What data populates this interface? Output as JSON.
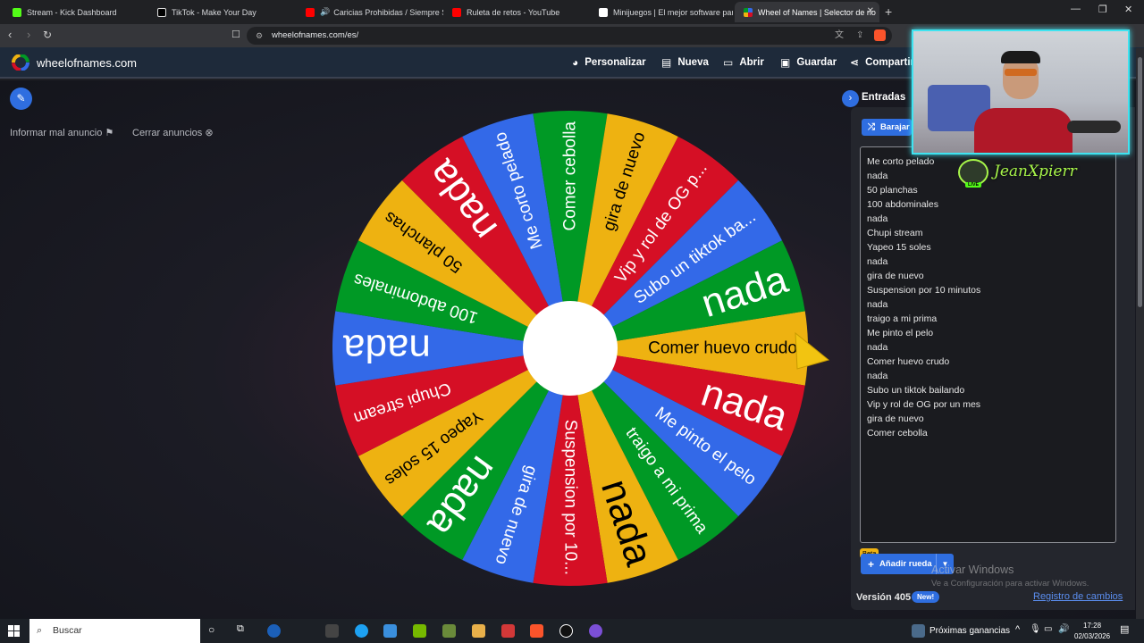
{
  "browser": {
    "tabs": [
      {
        "title": "Stream - Kick Dashboard",
        "color": "#53fc18"
      },
      {
        "title": "TikTok - Make Your Day",
        "color": "#000000"
      },
      {
        "title": "Caricias Prohibidas / Siempre Ser",
        "color": "#ff0000"
      },
      {
        "title": "Ruleta de retos - YouTube",
        "color": "#ff0000"
      },
      {
        "title": "Minijuegos | El mejor software para ¡",
        "color": "#ffffff"
      },
      {
        "title": "Wheel of Names | Selector de no",
        "color": "#3369e8"
      }
    ],
    "url": "wheelofnames.com/es/"
  },
  "site": {
    "logo": "wheelofnames.com",
    "menu": [
      "Personalizar",
      "Nueva",
      "Abrir",
      "Guardar",
      "Compartir"
    ]
  },
  "ads": {
    "report": "Informar mal anuncio",
    "close": "Cerrar anuncios"
  },
  "wheel": {
    "slices": [
      {
        "text": "Comer huevo crudo",
        "color": "#eeb211",
        "big": false
      },
      {
        "text": "nada",
        "color": "#d50f25",
        "big": true
      },
      {
        "text": "Me pinto el pelo",
        "color": "#3369e8",
        "big": false
      },
      {
        "text": "traigo a mi prima",
        "color": "#009925",
        "big": false
      },
      {
        "text": "nada",
        "color": "#eeb211",
        "big": true
      },
      {
        "text": "Suspension por 10...",
        "color": "#d50f25",
        "big": false
      },
      {
        "text": "gira de nuevo",
        "color": "#3369e8",
        "big": false
      },
      {
        "text": "nada",
        "color": "#009925",
        "big": true
      },
      {
        "text": "Yapeo 15 soles",
        "color": "#eeb211",
        "big": false
      },
      {
        "text": "Chupi stream",
        "color": "#d50f25",
        "big": false
      },
      {
        "text": "nada",
        "color": "#3369e8",
        "big": true
      },
      {
        "text": "100 abdominales",
        "color": "#009925",
        "big": false
      },
      {
        "text": "50 planchas",
        "color": "#eeb211",
        "big": false
      },
      {
        "text": "nada",
        "color": "#d50f25",
        "big": true
      },
      {
        "text": "Me corto pelado",
        "color": "#3369e8",
        "big": false
      },
      {
        "text": "Comer cebolla",
        "color": "#009925",
        "big": false
      },
      {
        "text": "gira de nuevo",
        "color": "#eeb211",
        "big": false
      },
      {
        "text": "Vip y rol de OG p...",
        "color": "#d50f25",
        "big": false
      },
      {
        "text": "Subo un tiktok ba...",
        "color": "#3369e8",
        "big": false
      },
      {
        "text": "nada",
        "color": "#009925",
        "big": true
      }
    ]
  },
  "panel": {
    "title": "Entradas",
    "shuffle": "Barajar",
    "entries": [
      "Me corto pelado",
      "nada",
      "50 planchas",
      "100 abdominales",
      "nada",
      "Chupi stream",
      "Yapeo 15 soles",
      "nada",
      "gira de nuevo",
      "Suspension por 10 minutos",
      "nada",
      "traigo a mi prima",
      "Me pinto el pelo",
      "nada",
      "Comer huevo crudo",
      "nada",
      "Subo un tiktok bailando",
      "Vip y rol de OG por un mes",
      "gira de nuevo",
      "Comer cebolla"
    ],
    "beta": "Beta",
    "add_wheel": "Añadir rueda",
    "version": "Versión 405",
    "new_badge": "New!",
    "changelog": "Registro de cambios"
  },
  "watermark": {
    "title": "Activar Windows",
    "sub": "Ve a Configuración para activar Windows."
  },
  "streamer": {
    "name": "JeanXpierr",
    "live": "LIVE"
  },
  "taskbar": {
    "search": "Buscar",
    "news": "Próximas ganancias",
    "time": "17:28",
    "date": "02/03/2026"
  }
}
